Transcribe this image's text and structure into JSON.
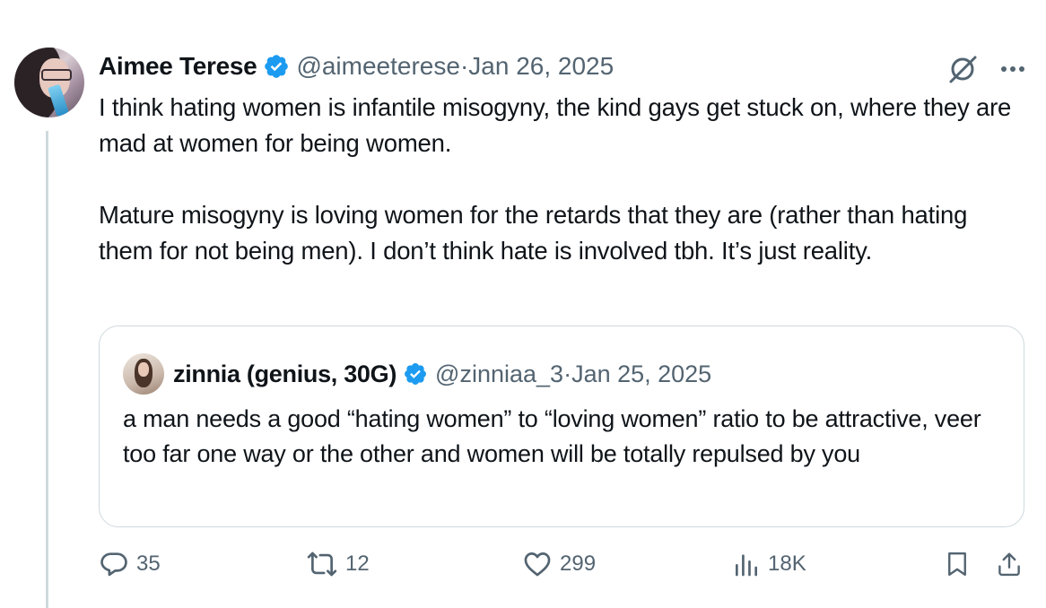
{
  "tweet": {
    "author": {
      "display_name": "Aimee Terese",
      "handle": "@aimeeterese",
      "date": "Jan 26, 2025",
      "verified": true,
      "avatar_icon": "profile-photo"
    },
    "meta_separator": " · ",
    "text": "I think hating women is infantile misogyny, the kind gays get stuck on, where they are mad at women for being women.\n\nMature misogyny is loving women for the retards that they are (rather than hating them for not being men). I don’t think hate is involved tbh. It’s just reality.",
    "header_icons": [
      "grok-icon",
      "more-icon"
    ]
  },
  "quoted_tweet": {
    "display_name": "zinnia (genius, 30G)",
    "handle": "@zinniaa_3",
    "date": "Jan 25, 2025",
    "verified": true,
    "text": "a man needs a good “hating women” to “loving women” ratio to be attractive, veer too far one way or the other and women will be totally repulsed by you"
  },
  "actions": {
    "reply_count": "35",
    "repost_count": "12",
    "like_count": "299",
    "views_count": "18K",
    "icons": [
      "reply-icon",
      "repost-icon",
      "like-icon",
      "views-icon",
      "bookmark-icon",
      "share-icon"
    ]
  },
  "colors": {
    "text": "#0f1419",
    "secondary": "#536471",
    "verified": "#1d9bf0",
    "border": "#cfd9de"
  }
}
